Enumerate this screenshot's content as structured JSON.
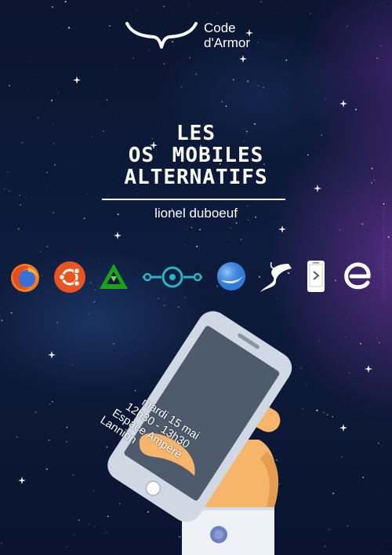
{
  "organizer": {
    "name_line1": "Code",
    "name_line2": "d'Armor"
  },
  "title": {
    "line1": "LES",
    "line2": "OS MOBILES",
    "line3": "ALTERNATIFS"
  },
  "author": "lionel duboeuf",
  "os_icons": [
    "firefox-os-icon",
    "ubuntu-touch-icon",
    "replicant-icon",
    "lineageos-icon",
    "sailfish-os-icon",
    "postmarketos-icon",
    "android-x86-icon",
    "e-foundation-icon"
  ],
  "event": {
    "date": "mardi 15 mai",
    "time": "12h30 - 13h30",
    "venue": "Espace Ampère",
    "city": "Lannion"
  },
  "colors": {
    "background": "#0d1b3c",
    "accent_purple": "#9b3cc0",
    "text": "#ffffff",
    "hand": "#f6b56a",
    "phone_body": "#cfd8e3",
    "phone_screen": "#4d5b6c",
    "sleeve": "#eef2f6"
  }
}
